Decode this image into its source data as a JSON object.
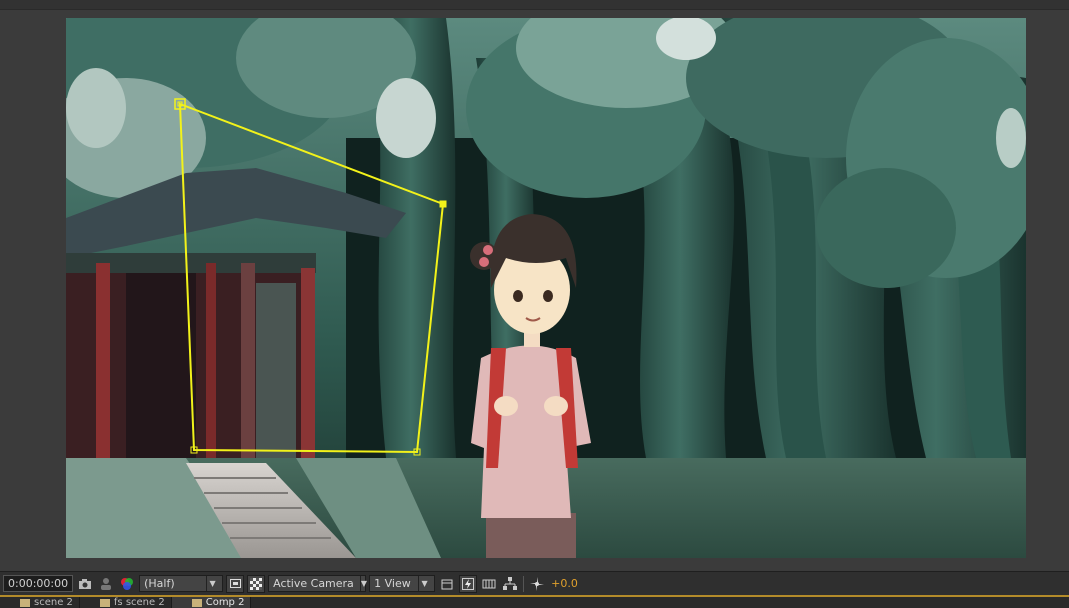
{
  "viewer": {
    "timecode": "0:00:00:00",
    "resolution": "(Half)",
    "camera": "Active Camera",
    "views": "1 View",
    "exposure": "+0.0"
  },
  "icons": {
    "snapshot": "camera-icon",
    "show_snapshot": "person-icon",
    "channels": "rgb-channels-icon",
    "roi": "region-of-interest-icon",
    "transparency": "transparency-grid-icon",
    "render": "fast-preview-icon",
    "timeline": "timeline-icon",
    "flowchart": "flowchart-icon",
    "reset_exposure": "exposure-icon"
  },
  "tabs": [
    {
      "label": "scene 2",
      "active": false
    },
    {
      "label": "fs scene 2",
      "active": false
    },
    {
      "label": "Comp 2",
      "active": true
    }
  ],
  "colors": {
    "mask_path": "#f2f21a",
    "exposure_text": "#e0a02c",
    "tab_highlight": "#b38b2a"
  }
}
